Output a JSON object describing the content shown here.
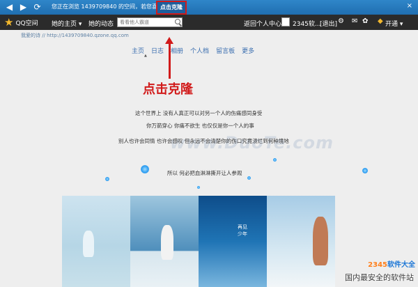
{
  "topbar": {
    "back_icon": "arrow-left-icon",
    "forward_icon": "arrow-right-icon",
    "refresh_icon": "refresh-icon",
    "banner_text": "您正在浏览 1439709840 的空间，若您喜欢，请",
    "clone_label": "点击克隆",
    "close_label": "×"
  },
  "qqbar": {
    "logo_text": "QQ空间",
    "items": [
      "她的主页 ▾",
      "她的动态"
    ],
    "search_placeholder": "看看他人霸道",
    "back_to_center": "返回个人中心",
    "username": "2345软...",
    "logout": "[退出]",
    "open_label": "开通 ▾"
  },
  "content": {
    "path_owner": "我爱的诗",
    "path_sep": " // ",
    "path_url": "http://1439709840.qzone.qq.com",
    "tabs": [
      "主页",
      "日志",
      "相册",
      "个人档",
      "留言板",
      "更多"
    ],
    "annotation": "点击克隆",
    "poem": [
      "这个世界上  没有人真正可以对另一个人的伤痛感同身受",
      "你万箭穿心  你痛不欲生  也仅仅是你一个人的事",
      "别人也许会同情  也许会感叹  但永远不会清楚你的伤口究竟溃烂到何种境地",
      "所以  何必把血淋淋撕开让人参观"
    ],
    "watermark": "www.DuoTe.com",
    "photo3_caption": "再见\n少年"
  },
  "brand": {
    "name_a": "2345",
    "name_b": "软件大全",
    "slogan": "国内最安全的软件站"
  },
  "colors": {
    "topbar": "#1f6eb0",
    "qqbar": "#2b2b2b",
    "content_bg": "#eeeeee",
    "tab_text": "#3b6fb0",
    "highlight_red": "#d11a1a"
  }
}
